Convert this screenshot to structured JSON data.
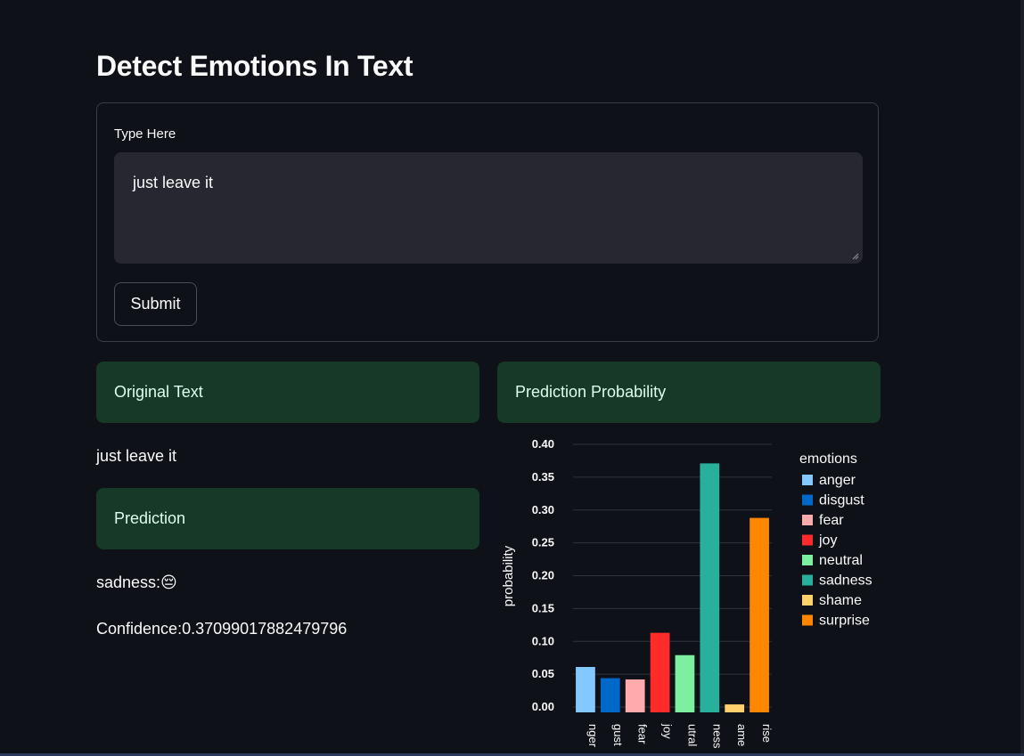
{
  "page": {
    "title": "Detect Emotions In Text"
  },
  "form": {
    "label": "Type Here",
    "input_value": "just leave it",
    "submit_label": "Submit"
  },
  "results": {
    "original_header": "Original Text",
    "original_value": "just leave it",
    "prediction_header": "Prediction",
    "prediction_value": "sadness:😔",
    "confidence_value": "Confidence:0.37099017882479796",
    "probability_header": "Prediction Probability"
  },
  "chart_data": {
    "type": "bar",
    "ylabel": "probability",
    "legend_title": "emotions",
    "legend_position": "right",
    "ylim": [
      0,
      0.4
    ],
    "yticks": [
      "0.00",
      "0.05",
      "0.10",
      "0.15",
      "0.20",
      "0.25",
      "0.30",
      "0.35",
      "0.40"
    ],
    "categories": [
      "anger",
      "disgust",
      "fear",
      "joy",
      "neutral",
      "sadness",
      "shame",
      "surprise"
    ],
    "tick_labels": [
      "nger",
      "gust",
      "fear",
      "joy",
      "utral",
      "ness",
      "ame",
      "rise"
    ],
    "values": [
      0.061,
      0.044,
      0.042,
      0.113,
      0.079,
      0.371,
      0.004,
      0.288
    ],
    "colors": [
      "#83c9ff",
      "#0068c9",
      "#ffabab",
      "#ff2b2b",
      "#7defa1",
      "#29b09d",
      "#ffd16a",
      "#ff8700"
    ],
    "grid": true
  }
}
